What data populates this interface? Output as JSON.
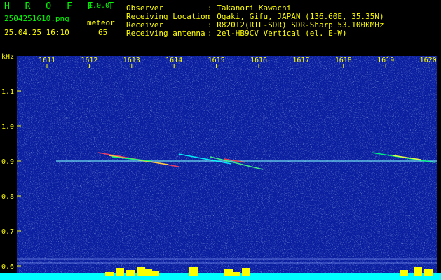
{
  "header": {
    "app_name": "H R O F F T",
    "version": "1.0.0",
    "filename": "2504251610.png",
    "datetime": "25.04.25 16:10",
    "meteor_label": "meteor",
    "meteor_count": "65",
    "fields": [
      {
        "label": "Observer",
        "value": ": Takanori Kawachi"
      },
      {
        "label": "Receiving Location",
        "value": ": Ogaki, Gifu, JAPAN (136.60E, 35.35N)"
      },
      {
        "label": "Receiver",
        "value": ": R820T2(RTL-SDR) SDR-Sharp 53.1000MHz"
      },
      {
        "label": "Receiving antenna",
        "value": ": 2el-HB9CV Vertical (el. E-W)"
      }
    ]
  },
  "spectrogram": {
    "y_unit": "kHz",
    "y_ticks": [
      "1.1",
      "1.0",
      "0.9",
      "0.8",
      "0.7",
      "0.6"
    ],
    "x_ticks": [
      "1611",
      "1612",
      "1613",
      "1614",
      "1615",
      "1616",
      "1617",
      "1618",
      "1619",
      "1620"
    ],
    "colors": {
      "background": "#0a1ea0",
      "carrier": "#80ffff",
      "noise_bar": "#00ffff",
      "activity": "#ffff00",
      "text": "#ffff00"
    }
  }
}
